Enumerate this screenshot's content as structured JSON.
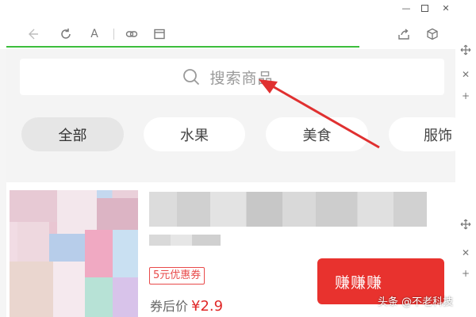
{
  "browser": {
    "window_controls": {
      "minimize_label": "—",
      "close_label": "✕"
    },
    "toolbar": {
      "font_button_label": "A"
    }
  },
  "search": {
    "placeholder": "搜索商品"
  },
  "categories": [
    {
      "label": "全部",
      "active": true
    },
    {
      "label": "水果",
      "active": false
    },
    {
      "label": "美食",
      "active": false
    },
    {
      "label": "服饰",
      "active": false
    }
  ],
  "product": {
    "coupon": "5元优惠券",
    "price_label": "券后价",
    "price_value": "¥2.9",
    "earn_button_label": "赚赚赚"
  },
  "watermark": "头条 @不老科技",
  "colors": {
    "accent_red": "#e8322e",
    "progress_green": "#3cbe3c",
    "annotation_arrow": "#e03030"
  }
}
